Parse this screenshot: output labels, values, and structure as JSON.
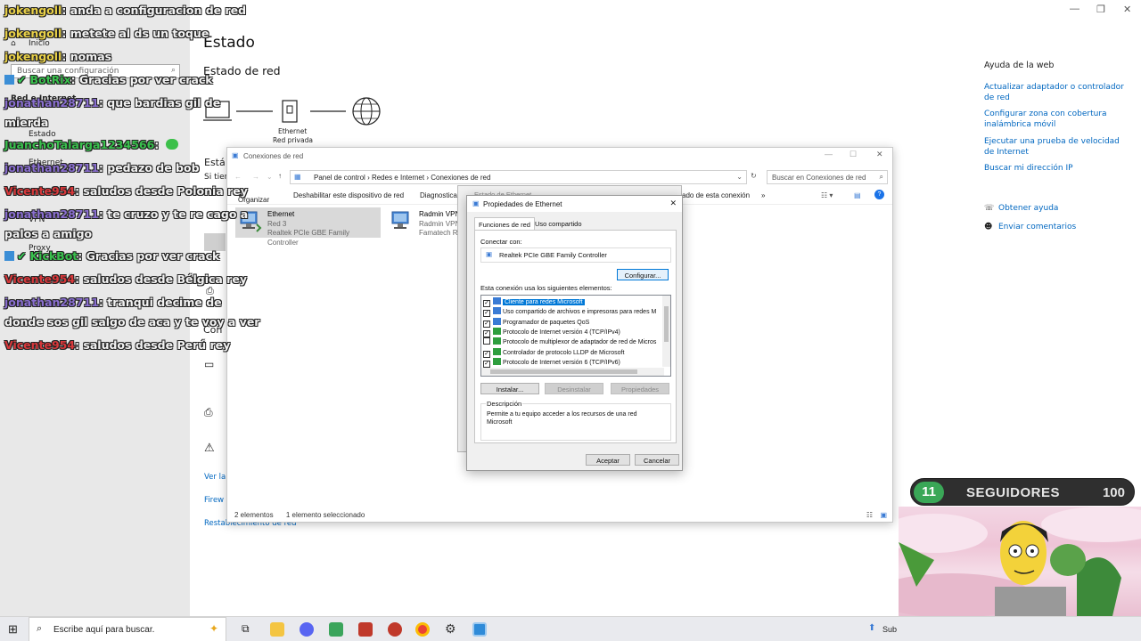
{
  "settings": {
    "title": "Estado",
    "subtitle": "Estado de red",
    "sidebar": {
      "home": "Inicio",
      "search_placeholder": "Buscar una configuración",
      "category": "Red e Internet",
      "items": [
        "Estado",
        "Ethernet",
        "VPN",
        "Proxy"
      ]
    },
    "diagram": {
      "device_label": "Ethernet",
      "network_label": "Red privada"
    },
    "partial_texts": {
      "estado": "Está",
      "si_tiene": "Si tien",
      "con": "Con"
    },
    "links": {
      "ver": "Ver la",
      "firewall": "Firew",
      "reset": "Restablecimiento de red"
    },
    "help": {
      "title": "Ayuda de la web",
      "links": [
        "Actualizar adaptador o controlador de red",
        "Configurar zona con cobertura inalámbrica móvil",
        "Ejecutar una prueba de velocidad de Internet",
        "Buscar mi dirección IP"
      ],
      "get_help": "Obtener ayuda",
      "feedback": "Enviar comentarios"
    }
  },
  "chat": [
    {
      "user": "jokengoll",
      "msg": ": anda a configuracion de red",
      "color": "yellow"
    },
    {
      "user": "jokengoll",
      "msg": ": metete al ds un toque",
      "color": "yellow"
    },
    {
      "user": "jokengoll",
      "msg": ": nomas",
      "color": "yellow"
    },
    {
      "user": "BotRix",
      "msg": ": Gracias por ver crack",
      "color": "green",
      "badge": true
    },
    {
      "user": "jonathan28711",
      "msg": ": que bardias gil de",
      "color": "purple"
    },
    {
      "user": "",
      "msg": "mierda",
      "color": ""
    },
    {
      "user": "JuanchoTalarga1234566",
      "msg": ":",
      "color": "green"
    },
    {
      "user": "jonathan28711",
      "msg": ": pedazo de bob",
      "color": "purple"
    },
    {
      "user": "Vicente954",
      "msg": ": saludos desde Polonia rey",
      "color": "red"
    },
    {
      "user": "jonathan28711",
      "msg": ": te cruzo y te re cago a",
      "color": "purple"
    },
    {
      "user": "",
      "msg": "palos a amigo",
      "color": ""
    },
    {
      "user": "KickBot",
      "msg": ": Gracias por ver crack",
      "color": "green",
      "badge": true
    },
    {
      "user": "Vicente954",
      "msg": ": saludos desde Bélgica rey",
      "color": "red"
    },
    {
      "user": "jonathan28711",
      "msg": ": tranqui decime de",
      "color": "purple"
    },
    {
      "user": "",
      "msg": "donde sos gil salgo de aca y te voy a ver",
      "color": ""
    },
    {
      "user": "Vicente954",
      "msg": ": saludos desde Perú rey",
      "color": "red"
    }
  ],
  "netconn": {
    "title": "Conexiones de red",
    "breadcrumb": [
      "Panel de control",
      "Redes e Internet",
      "Conexiones de red"
    ],
    "search_placeholder": "Buscar en Conexiones de red",
    "commands": [
      "Organizar",
      "Deshabilitar este dispositivo de red",
      "Diagnosticar",
      "ado de esta conexión",
      "»"
    ],
    "adapters": [
      {
        "name": "Ethernet",
        "network": "Red 3",
        "device": "Realtek PCIe GBE Family Controller"
      },
      {
        "name": "Radmin VPN",
        "network": "Radmin VPN",
        "device": "Famatech Ra"
      }
    ],
    "status": {
      "count": "2 elementos",
      "selected": "1 elemento seleccionado"
    }
  },
  "estado": {
    "title": "Estado de Ethernet"
  },
  "props": {
    "title": "Propiedades de Ethernet",
    "tabs": [
      "Funciones de red",
      "Uso compartido"
    ],
    "connect_using": "Conectar con:",
    "adapter": "Realtek PCIe GBE Family Controller",
    "configure": "Configurar...",
    "uses_label": "Esta conexión usa los siguientes elementos:",
    "items": [
      {
        "label": "Cliente para redes Microsoft",
        "checked": true,
        "selected": true
      },
      {
        "label": "Uso compartido de archivos e impresoras para redes M",
        "checked": true
      },
      {
        "label": "Programador de paquetes QoS",
        "checked": true
      },
      {
        "label": "Protocolo de Internet versión 4 (TCP/IPv4)",
        "checked": true
      },
      {
        "label": "Protocolo de multiplexor de adaptador de red de Micros",
        "checked": false
      },
      {
        "label": "Controlador de protocolo LLDP de Microsoft",
        "checked": true
      },
      {
        "label": "Protocolo de Internet versión 6 (TCP/IPv6)",
        "checked": true
      }
    ],
    "install": "Instalar...",
    "uninstall": "Desinstalar",
    "properties": "Propiedades",
    "description_label": "Descripción",
    "description": "Permite a tu equipo acceder a los recursos de una red Microsoft",
    "ok": "Aceptar",
    "cancel": "Cancelar"
  },
  "followers": {
    "count": "11",
    "label": "SEGUIDORES",
    "goal": "100"
  },
  "taskbar": {
    "search_placeholder": "Escribe aquí para buscar.",
    "tray_text": "Sub"
  }
}
